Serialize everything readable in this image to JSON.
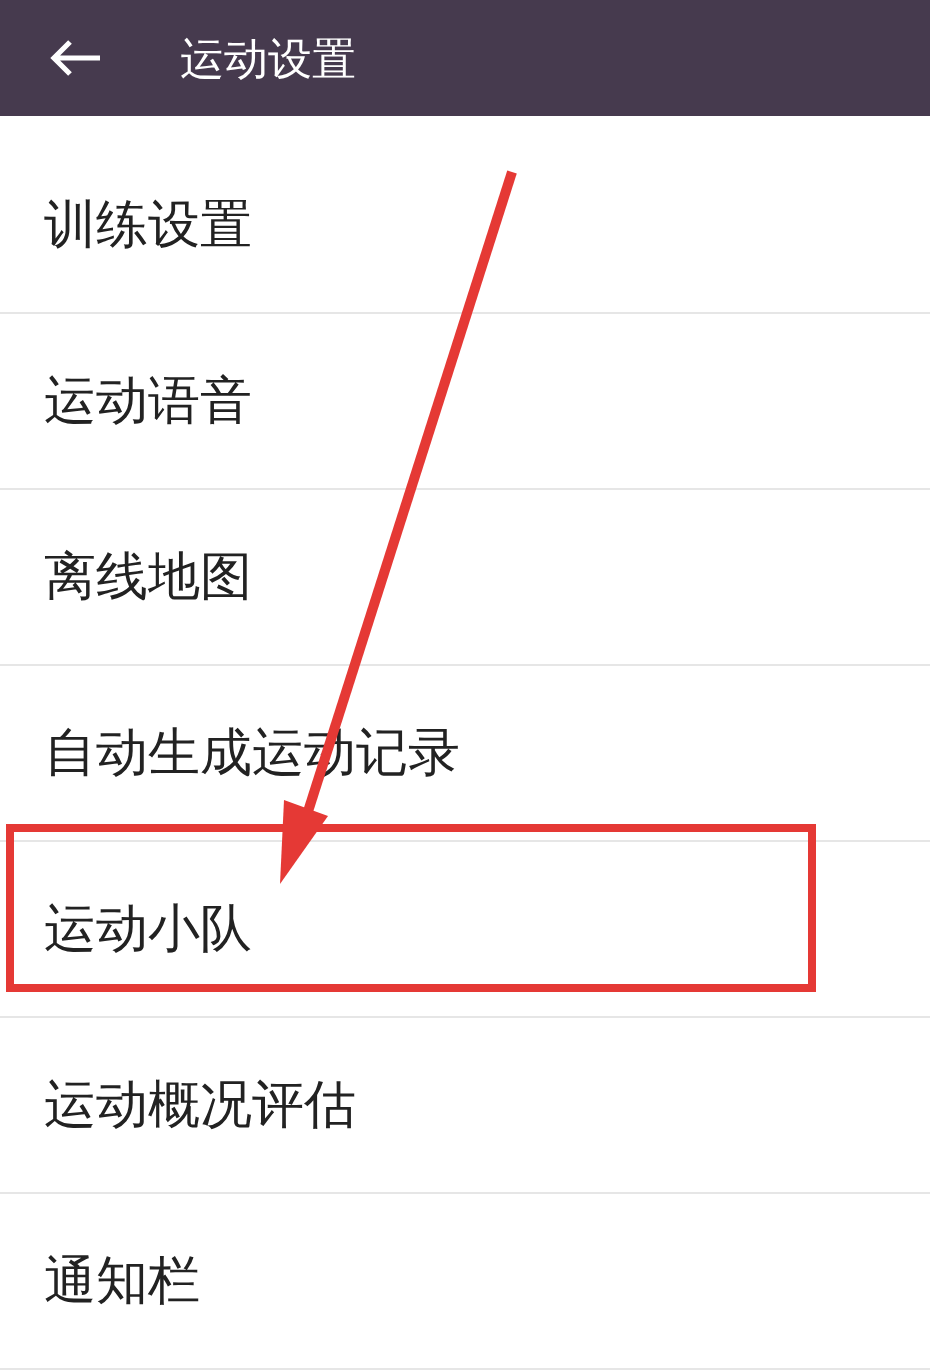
{
  "header": {
    "title": "运动设置"
  },
  "items": [
    {
      "label": "训练设置",
      "highlighted": false
    },
    {
      "label": "运动语音",
      "highlighted": false
    },
    {
      "label": "离线地图",
      "highlighted": false
    },
    {
      "label": "自动生成运动记录",
      "highlighted": false
    },
    {
      "label": "运动小队",
      "highlighted": true
    },
    {
      "label": "运动概况评估",
      "highlighted": false
    },
    {
      "label": "通知栏",
      "highlighted": false
    }
  ]
}
